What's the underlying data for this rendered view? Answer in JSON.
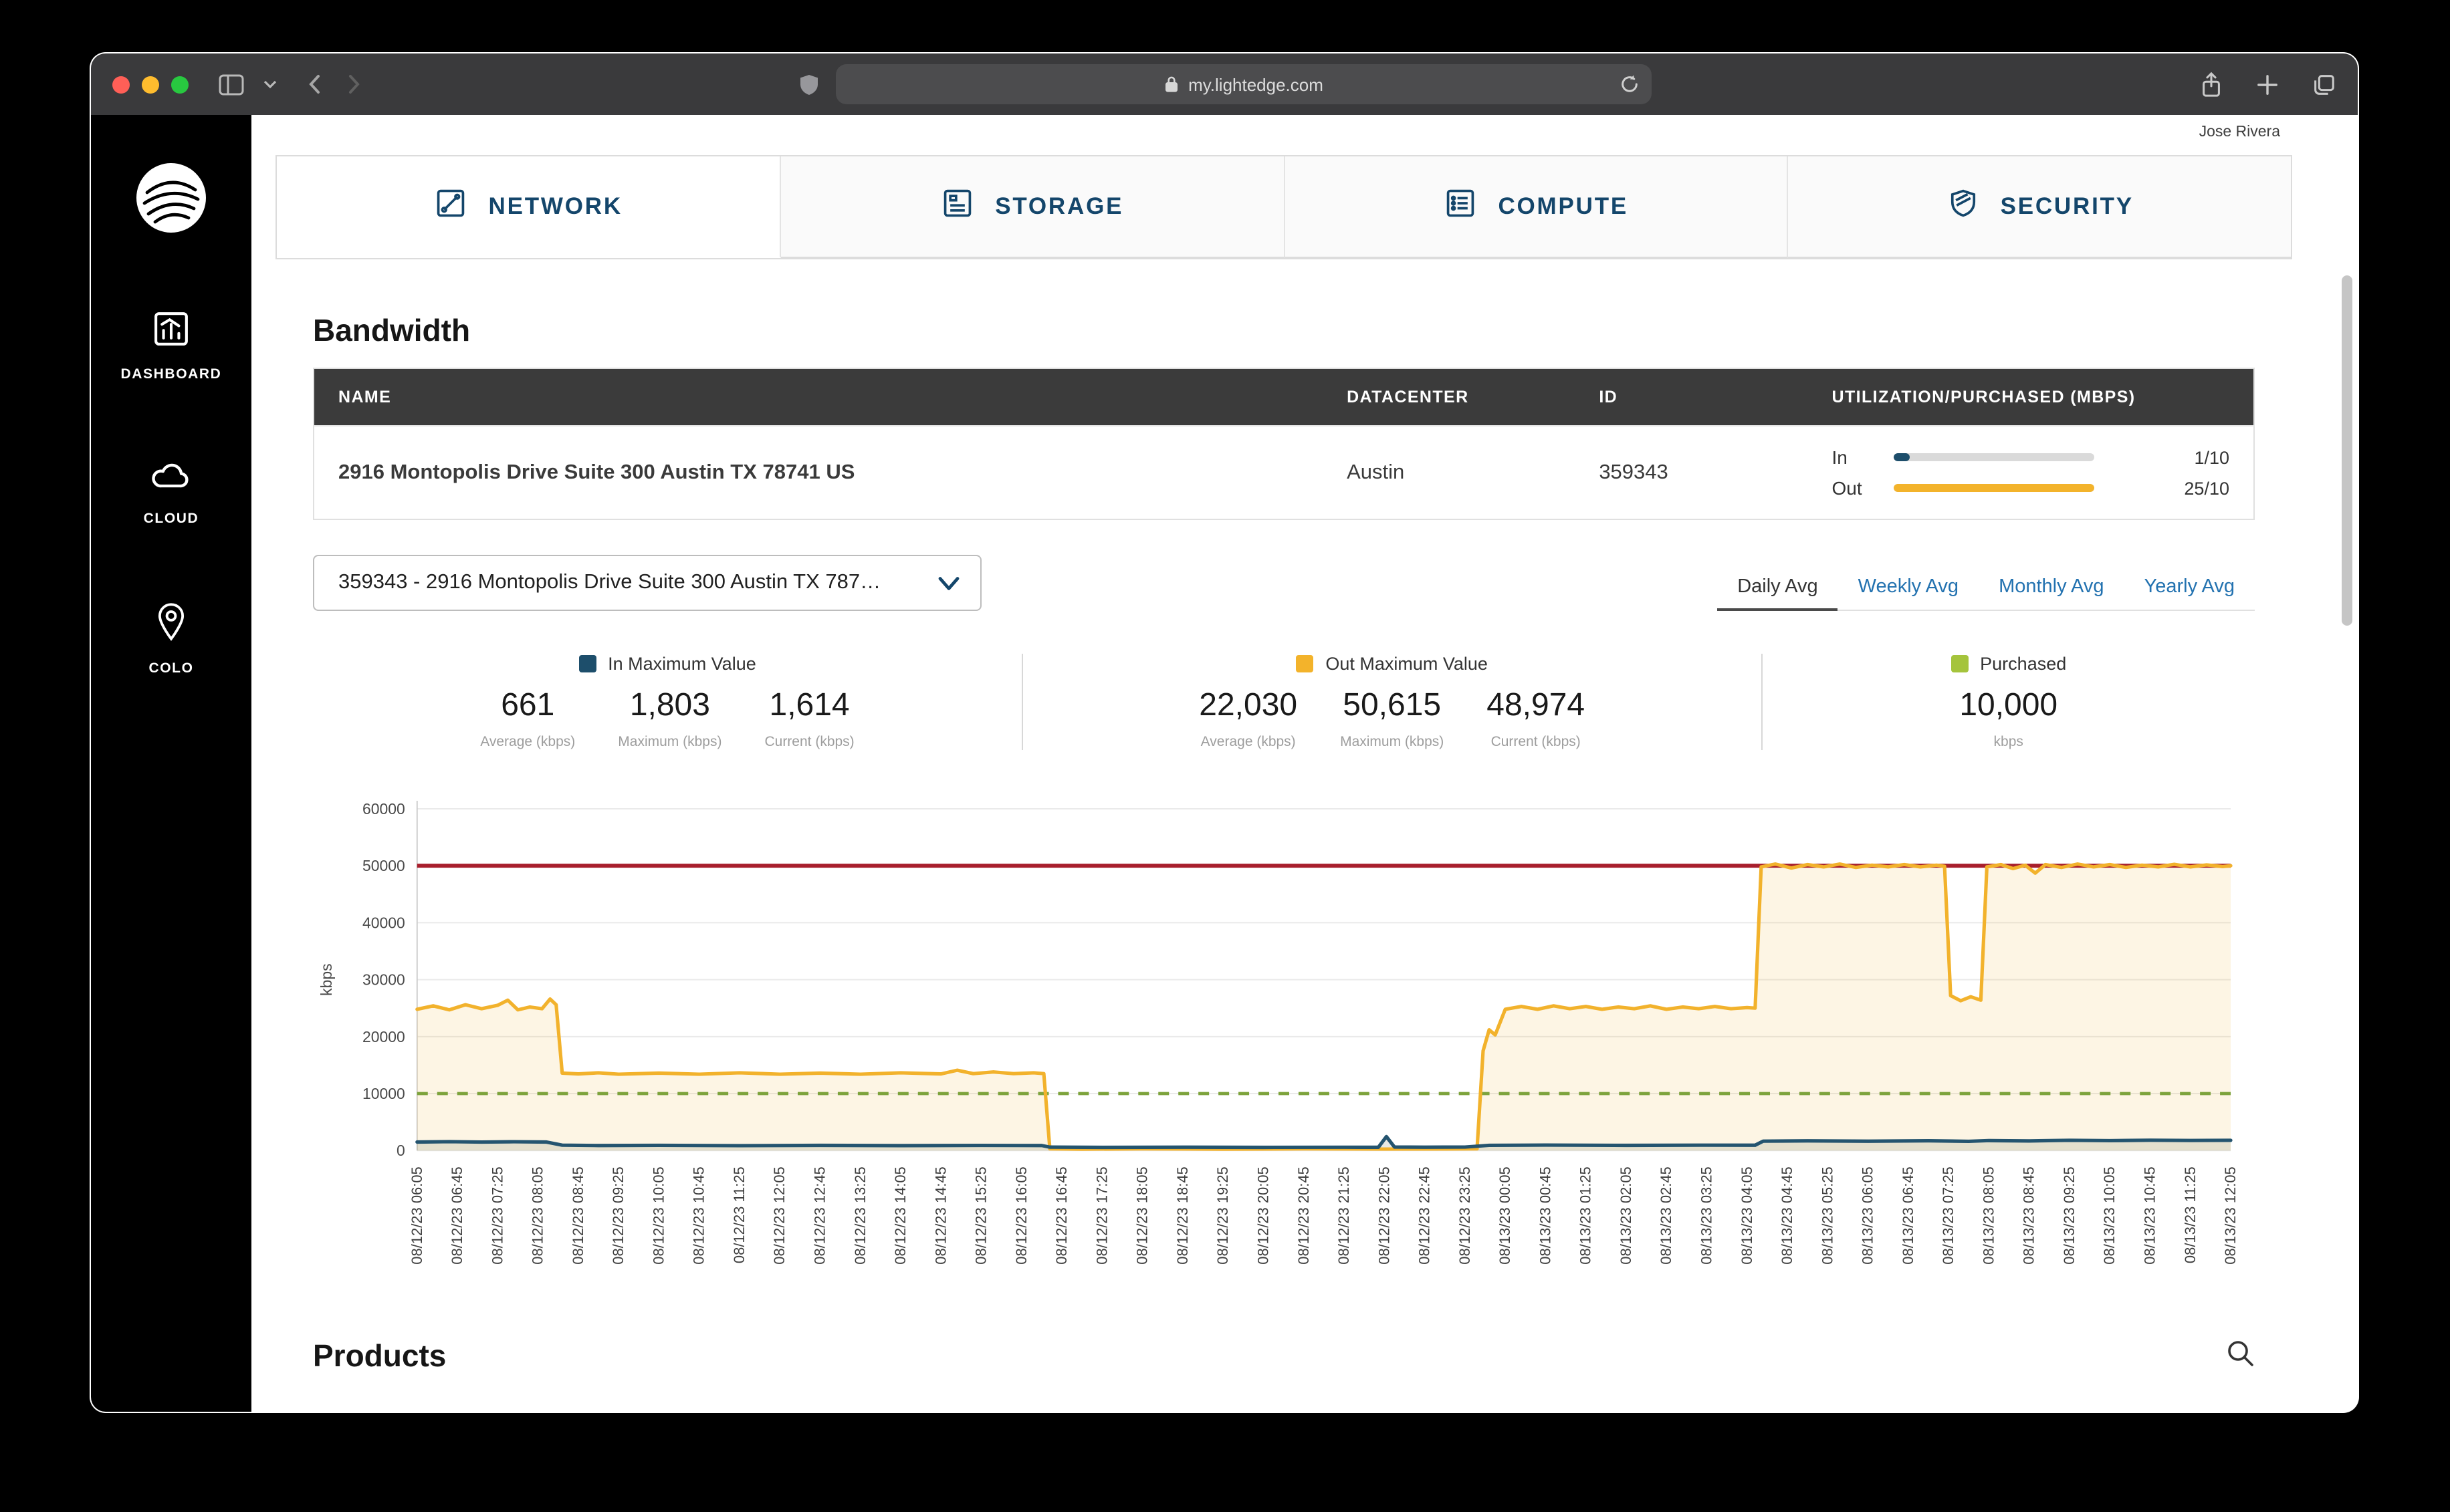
{
  "window": {
    "url": "my.lightedge.com",
    "user_name": "Jose Rivera"
  },
  "sidebar": {
    "items": [
      {
        "label": "DASHBOARD",
        "icon": "dashboard-icon"
      },
      {
        "label": "CLOUD",
        "icon": "cloud-icon"
      },
      {
        "label": "COLO",
        "icon": "colo-icon"
      }
    ]
  },
  "nav_tabs": [
    {
      "label": "NETWORK",
      "icon": "network-icon",
      "active": true
    },
    {
      "label": "STORAGE",
      "icon": "storage-icon",
      "active": false
    },
    {
      "label": "COMPUTE",
      "icon": "compute-icon",
      "active": false
    },
    {
      "label": "SECURITY",
      "icon": "security-icon",
      "active": false
    }
  ],
  "bandwidth": {
    "section_title": "Bandwidth",
    "table": {
      "headers": [
        "NAME",
        "DATACENTER",
        "ID",
        "UTILIZATION/PURCHASED (MBPS)"
      ],
      "row": {
        "name": "2916 Montopolis Drive Suite 300 Austin TX 78741 US",
        "datacenter": "Austin",
        "id": "359343",
        "in": {
          "label": "In",
          "value": "1/10",
          "fill_width": "8%",
          "color": "#1d4e6b"
        },
        "out": {
          "label": "Out",
          "value": "25/10",
          "fill_width": "100%",
          "color": "#f3b32b"
        }
      }
    },
    "circuit_selector": {
      "value": "359343 - 2916 Montopolis Drive Suite 300 Austin TX 787…"
    },
    "avg_tabs": [
      "Daily Avg",
      "Weekly Avg",
      "Monthly Avg",
      "Yearly Avg"
    ],
    "active_avg_tab": "Daily Avg",
    "stats": {
      "in": {
        "title": "In Maximum Value",
        "swatch_color": "#1d4e6b",
        "average": "661",
        "maximum": "1,803",
        "current": "1,614",
        "labels": [
          "Average (kbps)",
          "Maximum (kbps)",
          "Current (kbps)"
        ]
      },
      "out": {
        "title": "Out Maximum Value",
        "swatch_color": "#f3b32b",
        "average": "22,030",
        "maximum": "50,615",
        "current": "48,974",
        "labels": [
          "Average (kbps)",
          "Maximum (kbps)",
          "Current (kbps)"
        ]
      },
      "purchased": {
        "title": "Purchased",
        "swatch_color": "#a5c43c",
        "value": "10,000",
        "unit_label": "kbps"
      }
    }
  },
  "chart_data": {
    "type": "line",
    "ylabel": "kbps",
    "ylim": [
      0,
      60000
    ],
    "ytick_step": 10000,
    "grid": "horizontal",
    "x_labels": [
      "08/12/23 06:05",
      "08/12/23 06:45",
      "08/12/23 07:25",
      "08/12/23 08:05",
      "08/12/23 08:45",
      "08/12/23 09:25",
      "08/12/23 10:05",
      "08/12/23 10:45",
      "08/12/23 11:25",
      "08/12/23 12:05",
      "08/12/23 12:45",
      "08/12/23 13:25",
      "08/12/23 14:05",
      "08/12/23 14:45",
      "08/12/23 15:25",
      "08/12/23 16:05",
      "08/12/23 16:45",
      "08/12/23 17:25",
      "08/12/23 18:05",
      "08/12/23 18:45",
      "08/12/23 19:25",
      "08/12/23 20:05",
      "08/12/23 20:45",
      "08/12/23 21:25",
      "08/12/23 22:05",
      "08/12/23 22:45",
      "08/12/23 23:25",
      "08/13/23 00:05",
      "08/13/23 00:45",
      "08/13/23 01:25",
      "08/13/23 02:05",
      "08/13/23 02:45",
      "08/13/23 03:25",
      "08/13/23 04:05",
      "08/13/23 04:45",
      "08/13/23 05:25",
      "08/13/23 06:05",
      "08/13/23 06:45",
      "08/13/23 07:25",
      "08/13/23 08:05",
      "08/13/23 08:45",
      "08/13/23 09:25",
      "08/13/23 10:05",
      "08/13/23 10:45",
      "08/13/23 11:25",
      "08/13/23 12:05"
    ],
    "series": [
      {
        "name": "Out",
        "color": "#f2b22c",
        "fill": "rgba(242,178,44,0.13)",
        "points": [
          [
            0,
            24800
          ],
          [
            0.4,
            25400
          ],
          [
            0.8,
            24700
          ],
          [
            1.2,
            25600
          ],
          [
            1.6,
            24900
          ],
          [
            2.0,
            25500
          ],
          [
            2.25,
            26400
          ],
          [
            2.5,
            24700
          ],
          [
            2.8,
            25200
          ],
          [
            3.1,
            24900
          ],
          [
            3.3,
            26600
          ],
          [
            3.45,
            25600
          ],
          [
            3.6,
            13600
          ],
          [
            4,
            13450
          ],
          [
            4.5,
            13650
          ],
          [
            5,
            13400
          ],
          [
            6,
            13600
          ],
          [
            7,
            13400
          ],
          [
            8,
            13650
          ],
          [
            9,
            13400
          ],
          [
            10,
            13600
          ],
          [
            11,
            13400
          ],
          [
            12,
            13650
          ],
          [
            13,
            13450
          ],
          [
            13.4,
            14100
          ],
          [
            13.8,
            13500
          ],
          [
            14.3,
            13800
          ],
          [
            14.8,
            13500
          ],
          [
            15.3,
            13650
          ],
          [
            15.55,
            13500
          ],
          [
            15.7,
            300
          ],
          [
            16.5,
            250
          ],
          [
            18,
            300
          ],
          [
            20,
            250
          ],
          [
            22,
            300
          ],
          [
            24,
            260
          ],
          [
            25.5,
            280
          ],
          [
            26.3,
            300
          ],
          [
            26.45,
            17500
          ],
          [
            26.6,
            21200
          ],
          [
            26.75,
            20300
          ],
          [
            27,
            24800
          ],
          [
            27.4,
            25300
          ],
          [
            27.8,
            24800
          ],
          [
            28.2,
            25400
          ],
          [
            28.6,
            24900
          ],
          [
            29,
            25300
          ],
          [
            29.4,
            24800
          ],
          [
            29.8,
            25200
          ],
          [
            30.2,
            24900
          ],
          [
            30.6,
            25400
          ],
          [
            31,
            24800
          ],
          [
            31.4,
            25200
          ],
          [
            31.8,
            24900
          ],
          [
            32.2,
            25300
          ],
          [
            32.6,
            24900
          ],
          [
            33,
            25100
          ],
          [
            33.2,
            25000
          ],
          [
            33.35,
            49800
          ],
          [
            33.7,
            50300
          ],
          [
            34.1,
            49600
          ],
          [
            34.5,
            50200
          ],
          [
            34.9,
            49800
          ],
          [
            35.3,
            50300
          ],
          [
            35.7,
            49700
          ],
          [
            36.1,
            50100
          ],
          [
            36.5,
            49800
          ],
          [
            36.9,
            50200
          ],
          [
            37.3,
            49800
          ],
          [
            37.7,
            50100
          ],
          [
            37.9,
            49900
          ],
          [
            38.05,
            27200
          ],
          [
            38.3,
            26300
          ],
          [
            38.55,
            27000
          ],
          [
            38.8,
            26400
          ],
          [
            38.95,
            49800
          ],
          [
            39.3,
            50200
          ],
          [
            39.6,
            49500
          ],
          [
            39.9,
            50100
          ],
          [
            40.15,
            48700
          ],
          [
            40.4,
            50200
          ],
          [
            40.8,
            49700
          ],
          [
            41.2,
            50300
          ],
          [
            41.6,
            49800
          ],
          [
            42,
            50200
          ],
          [
            42.4,
            49700
          ],
          [
            42.8,
            50100
          ],
          [
            43.2,
            49800
          ],
          [
            43.6,
            50250
          ],
          [
            44,
            49800
          ],
          [
            44.4,
            50150
          ],
          [
            44.8,
            49850
          ],
          [
            45,
            50000
          ]
        ]
      },
      {
        "name": "In",
        "color": "#24546f",
        "fill": "rgba(105,120,90,0.16)",
        "points": [
          [
            0,
            1500
          ],
          [
            0.8,
            1560
          ],
          [
            1.6,
            1490
          ],
          [
            2.4,
            1550
          ],
          [
            3.2,
            1500
          ],
          [
            3.6,
            950
          ],
          [
            4.5,
            880
          ],
          [
            6,
            920
          ],
          [
            8,
            860
          ],
          [
            10,
            910
          ],
          [
            12,
            870
          ],
          [
            14,
            900
          ],
          [
            15.5,
            880
          ],
          [
            15.7,
            600
          ],
          [
            17,
            560
          ],
          [
            19,
            590
          ],
          [
            21,
            560
          ],
          [
            23,
            580
          ],
          [
            23.85,
            570
          ],
          [
            24.05,
            2450
          ],
          [
            24.25,
            620
          ],
          [
            25,
            590
          ],
          [
            26,
            610
          ],
          [
            26.6,
            920
          ],
          [
            28,
            960
          ],
          [
            30,
            910
          ],
          [
            32,
            950
          ],
          [
            33.2,
            940
          ],
          [
            33.4,
            1650
          ],
          [
            34.5,
            1700
          ],
          [
            36,
            1640
          ],
          [
            37.5,
            1720
          ],
          [
            38.5,
            1620
          ],
          [
            39,
            1750
          ],
          [
            40,
            1690
          ],
          [
            41,
            1800
          ],
          [
            42,
            1740
          ],
          [
            43,
            1810
          ],
          [
            44,
            1770
          ],
          [
            45,
            1800
          ]
        ]
      },
      {
        "name": "Purchased",
        "style": "dashed",
        "color": "#7da33c",
        "value": 10000
      },
      {
        "name": "Cap",
        "style": "solid",
        "color": "#a81e2c",
        "value": 50000
      }
    ]
  },
  "products": {
    "section_title": "Products"
  }
}
